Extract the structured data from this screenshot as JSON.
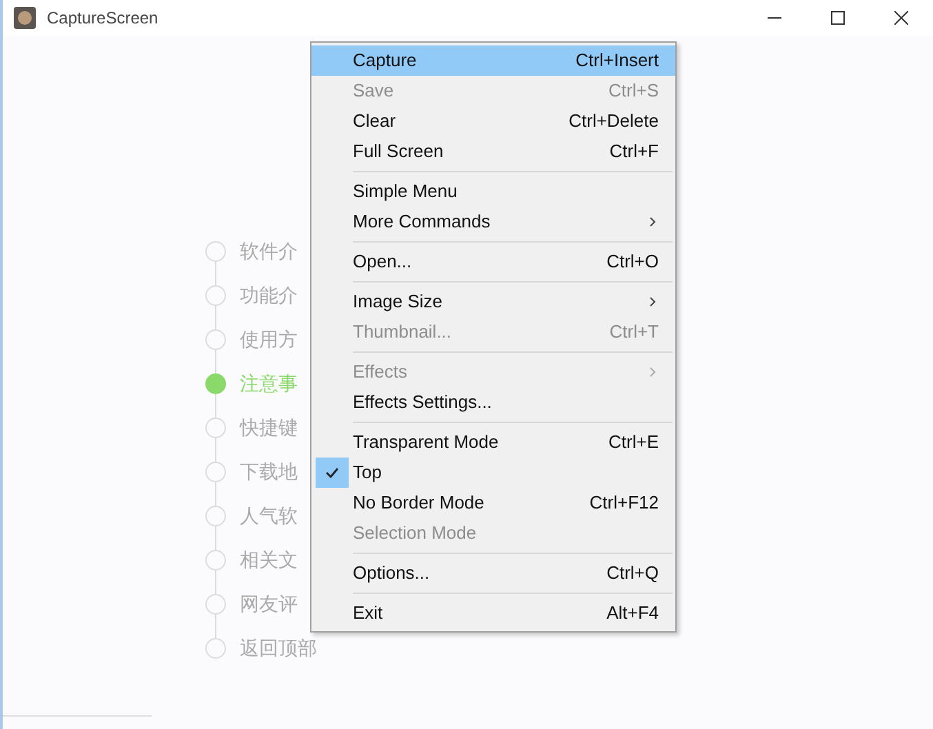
{
  "window": {
    "title": "CaptureScreen"
  },
  "nav": [
    {
      "label": "软件介",
      "selected": false
    },
    {
      "label": "功能介",
      "selected": false
    },
    {
      "label": "使用方",
      "selected": false
    },
    {
      "label": "注意事",
      "selected": true
    },
    {
      "label": "快捷键",
      "selected": false
    },
    {
      "label": "下载地",
      "selected": false
    },
    {
      "label": "人气软",
      "selected": false
    },
    {
      "label": "相关文",
      "selected": false
    },
    {
      "label": "网友评",
      "selected": false
    },
    {
      "label": "返回顶部",
      "selected": false
    }
  ],
  "menu": {
    "groups": [
      [
        {
          "label": "Capture",
          "shortcut": "Ctrl+Insert",
          "selected": true,
          "disabled": false,
          "checked": false,
          "submenu": false
        },
        {
          "label": "Save",
          "shortcut": "Ctrl+S",
          "selected": false,
          "disabled": true,
          "checked": false,
          "submenu": false
        },
        {
          "label": "Clear",
          "shortcut": "Ctrl+Delete",
          "selected": false,
          "disabled": false,
          "checked": false,
          "submenu": false
        },
        {
          "label": "Full Screen",
          "shortcut": "Ctrl+F",
          "selected": false,
          "disabled": false,
          "checked": false,
          "submenu": false
        }
      ],
      [
        {
          "label": "Simple Menu",
          "selected": false,
          "disabled": false,
          "checked": false,
          "submenu": false
        },
        {
          "label": "More Commands",
          "selected": false,
          "disabled": false,
          "checked": false,
          "submenu": true
        }
      ],
      [
        {
          "label": "Open...",
          "shortcut": "Ctrl+O",
          "selected": false,
          "disabled": false,
          "checked": false,
          "submenu": false
        }
      ],
      [
        {
          "label": "Image Size",
          "selected": false,
          "disabled": false,
          "checked": false,
          "submenu": true
        },
        {
          "label": "Thumbnail...",
          "shortcut": "Ctrl+T",
          "selected": false,
          "disabled": true,
          "checked": false,
          "submenu": false
        }
      ],
      [
        {
          "label": "Effects",
          "selected": false,
          "disabled": true,
          "checked": false,
          "submenu": true
        },
        {
          "label": "Effects Settings...",
          "selected": false,
          "disabled": false,
          "checked": false,
          "submenu": false
        }
      ],
      [
        {
          "label": "Transparent Mode",
          "shortcut": "Ctrl+E",
          "selected": false,
          "disabled": false,
          "checked": false,
          "submenu": false
        },
        {
          "label": "Top",
          "selected": false,
          "disabled": false,
          "checked": true,
          "submenu": false
        },
        {
          "label": "No Border Mode",
          "shortcut": "Ctrl+F12",
          "selected": false,
          "disabled": false,
          "checked": false,
          "submenu": false
        },
        {
          "label": "Selection Mode",
          "selected": false,
          "disabled": true,
          "checked": false,
          "submenu": false
        }
      ],
      [
        {
          "label": "Options...",
          "shortcut": "Ctrl+Q",
          "selected": false,
          "disabled": false,
          "checked": false,
          "submenu": false
        }
      ],
      [
        {
          "label": "Exit",
          "shortcut": "Alt+F4",
          "selected": false,
          "disabled": false,
          "checked": false,
          "submenu": false
        }
      ]
    ]
  }
}
